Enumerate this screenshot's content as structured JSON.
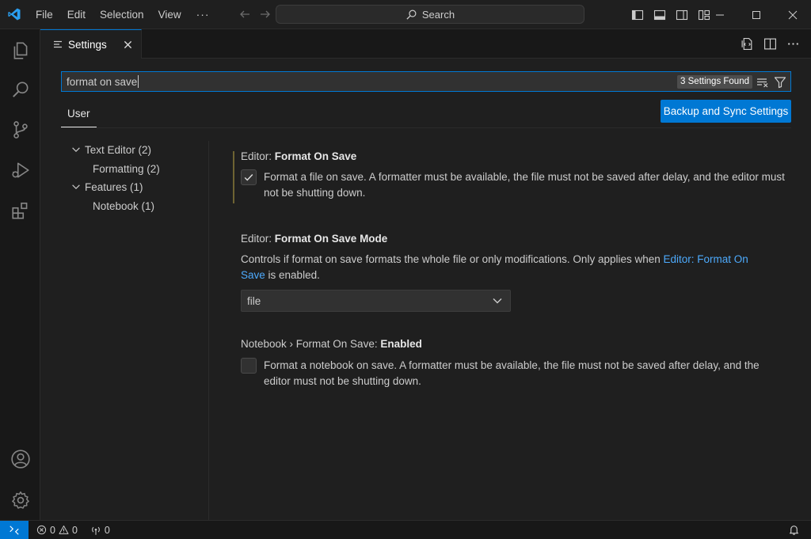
{
  "menu": {
    "file": "File",
    "edit": "Edit",
    "selection": "Selection",
    "view": "View",
    "more": "···"
  },
  "command_center": {
    "label": "Search"
  },
  "tab": {
    "label": "Settings"
  },
  "search": {
    "value": "format on save",
    "results_badge": "3 Settings Found"
  },
  "scope_tabs": {
    "user": "User"
  },
  "sync_button": {
    "label": "Backup and Sync Settings"
  },
  "toc": [
    {
      "label": "Text Editor (2)"
    },
    {
      "label": "Formatting (2)"
    },
    {
      "label": "Features (1)"
    },
    {
      "label": "Notebook (1)"
    }
  ],
  "settings": [
    {
      "category": "Editor: ",
      "name": "Format On Save",
      "description": "Format a file on save. A formatter must be available, the file must not be saved after delay, and the editor must not be shutting down.",
      "checked": true
    },
    {
      "category": "Editor: ",
      "name": "Format On Save Mode",
      "description_before": "Controls if format on save formats the whole file or only modifications. Only applies when ",
      "description_link": "Editor: Format On Save",
      "description_after": " is enabled.",
      "select_value": "file"
    },
    {
      "category": "Notebook › Format On Save: ",
      "name": "Enabled",
      "description": "Format a notebook on save. A formatter must be available, the file must not be saved after delay, and the editor must not be shutting down.",
      "checked": false
    }
  ],
  "status": {
    "errors": "0",
    "warnings": "0",
    "ports": "0"
  },
  "colors": {
    "accent": "#0078d4",
    "link": "#4daafc",
    "background": "#1f1f1f",
    "sidebar": "#181818"
  }
}
